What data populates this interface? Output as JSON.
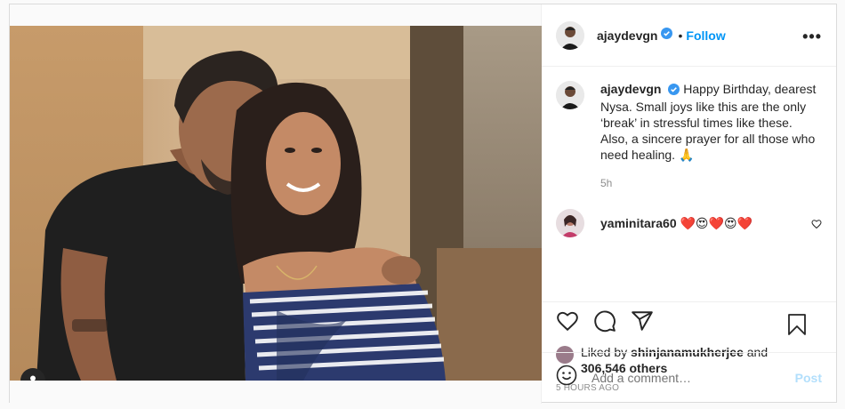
{
  "post": {
    "author": {
      "username": "ajaydevgn",
      "verified": true
    },
    "header": {
      "dot": "•",
      "follow_label": "Follow",
      "more_label": "•••"
    },
    "caption": {
      "username": "ajaydevgn",
      "text": "Happy Birthday, dearest Nysa. Small joys like this are the only ‘break’ in stressful times like these.",
      "text2": "Also, a sincere prayer for all those who need healing. 🙏",
      "time": "5h"
    },
    "comments": [
      {
        "username": "yaminitara60",
        "text": "❤️😍❤️😍❤️"
      }
    ],
    "likes": {
      "prefix": "Liked by",
      "liker": "shinjanamukherjee",
      "connector": "and",
      "others": "306,546 others"
    },
    "posted_ago": "5 HOURS AGO",
    "add_comment": {
      "placeholder": "Add a comment…",
      "post_label": "Post"
    }
  },
  "colors": {
    "link_blue": "#0095f6",
    "post_disabled": "#b2dffc",
    "muted": "#8e8e8e",
    "text": "#262626"
  },
  "icons": [
    "user-tag-icon",
    "verified-badge-icon",
    "more-options-icon",
    "heart-icon",
    "comment-icon",
    "share-icon",
    "bookmark-icon",
    "emoji-icon",
    "small-heart-icon"
  ]
}
